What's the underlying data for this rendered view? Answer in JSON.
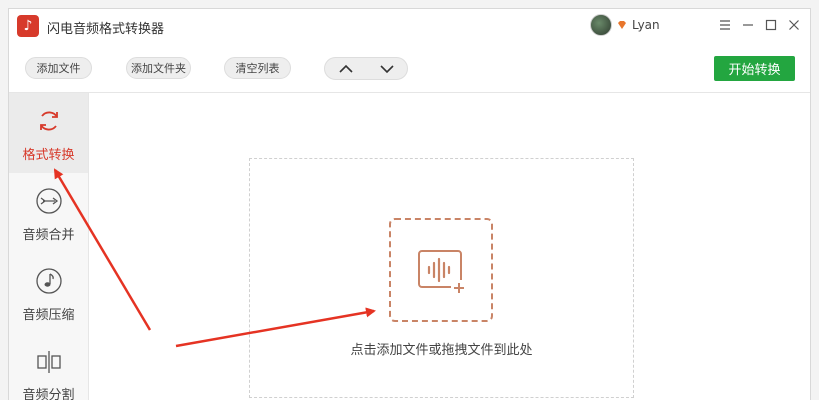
{
  "app": {
    "title": "闪电音频格式转换器"
  },
  "user": {
    "name": "Lyan"
  },
  "toolbar": {
    "add_file": "添加文件",
    "add_folder": "添加文件夹",
    "clear_list": "清空列表",
    "start": "开始转换"
  },
  "sidebar": {
    "items": [
      {
        "label": "格式转换",
        "icon": "refresh-icon",
        "active": true
      },
      {
        "label": "音频合并",
        "icon": "merge-icon",
        "active": false
      },
      {
        "label": "音频压缩",
        "icon": "compress-icon",
        "active": false
      },
      {
        "label": "音频分割",
        "icon": "split-icon",
        "active": false
      }
    ]
  },
  "main": {
    "drop_hint": "点击添加文件或拖拽文件到此处"
  },
  "colors": {
    "accent": "#d73a2b",
    "start": "#23a640",
    "drop_border": "#c98466",
    "annotation": "#e53323"
  }
}
